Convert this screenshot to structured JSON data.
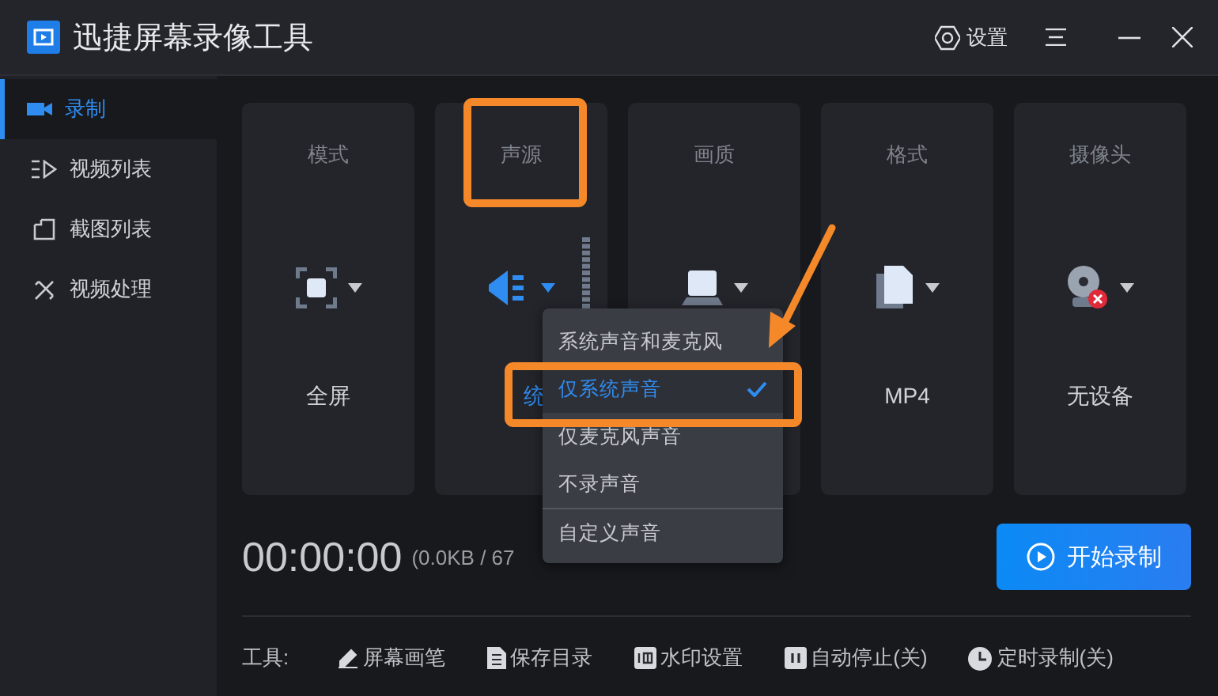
{
  "window": {
    "title": "迅捷屏幕录像工具",
    "settings": "设置"
  },
  "sidebar": {
    "items": [
      {
        "label": "录制",
        "kind": "record",
        "selected": true
      },
      {
        "label": "视频列表",
        "kind": "videos",
        "selected": false
      },
      {
        "label": "截图列表",
        "kind": "shots",
        "selected": false
      },
      {
        "label": "视频处理",
        "kind": "edit",
        "selected": false
      }
    ]
  },
  "cards": [
    {
      "label": "模式",
      "value": "全屏",
      "kind": "mode"
    },
    {
      "label": "声源",
      "value": "统",
      "kind": "audio"
    },
    {
      "label": "画质",
      "kind": "quality"
    },
    {
      "label": "格式",
      "value": "MP4",
      "kind": "format"
    },
    {
      "label": "摄像头",
      "value": "无设备",
      "kind": "camera"
    }
  ],
  "audio_menu": {
    "items": [
      {
        "label": "系统声音和麦克风",
        "kind": "option",
        "selected": false
      },
      {
        "label": "仅系统声音",
        "kind": "option",
        "selected": true
      },
      {
        "label": "仅麦克风声音",
        "kind": "option",
        "selected": false
      },
      {
        "label": "不录声音",
        "kind": "option",
        "selected": false
      },
      {
        "label": "自定义声音",
        "kind": "custom",
        "selected": false
      }
    ]
  },
  "timer": "00:00:00",
  "size": "(0.0KB / 67",
  "start_button": "开始录制",
  "tools": {
    "label": "工具:",
    "items": [
      {
        "label": "屏幕画笔",
        "kind": "pen"
      },
      {
        "label": "保存目录",
        "kind": "folder"
      },
      {
        "label": "水印设置",
        "kind": "watermark"
      },
      {
        "label": "自动停止(关)",
        "kind": "stop"
      },
      {
        "label": "定时录制(关)",
        "kind": "timer"
      }
    ]
  }
}
